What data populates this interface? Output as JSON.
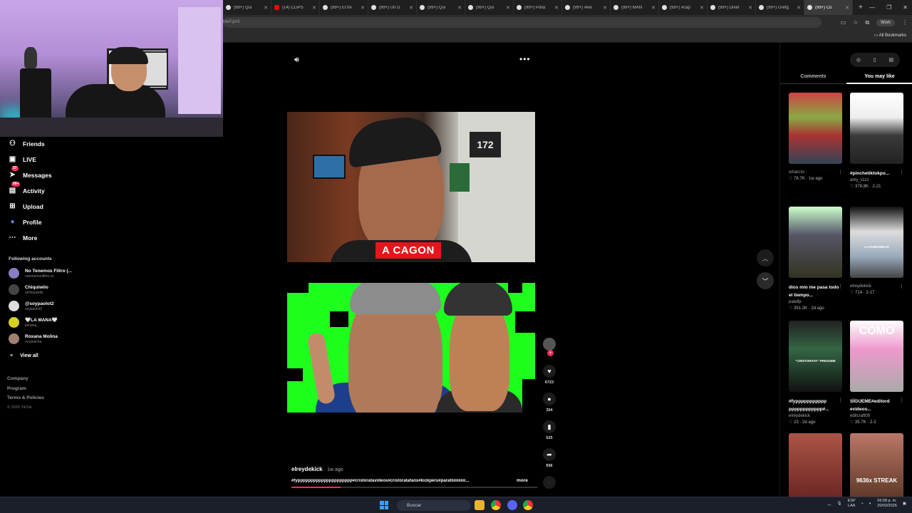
{
  "browser": {
    "tabs": [
      {
        "label": "(99+) Qui",
        "icon": "tiktok-icon"
      },
      {
        "label": "(14) CLIPS",
        "icon": "youtube-icon"
      },
      {
        "label": "(99+) El tre",
        "icon": "tiktok-icon"
      },
      {
        "label": "(99+) Un D",
        "icon": "tiktok-icon"
      },
      {
        "label": "(99+) Qui",
        "icon": "tiktok-icon"
      },
      {
        "label": "(99+) Qui",
        "icon": "tiktok-icon"
      },
      {
        "label": "(99+) Polla",
        "icon": "tiktok-icon"
      },
      {
        "label": "(99+) #we",
        "icon": "tiktok-icon"
      },
      {
        "label": "(99+) MAN",
        "icon": "tiktok-icon"
      },
      {
        "label": "(99+) #cap",
        "icon": "tiktok-icon"
      },
      {
        "label": "(99+) Diver",
        "icon": "tiktok-icon"
      },
      {
        "label": "(99+) Grefg",
        "icon": "tiktok-icon"
      },
      {
        "label": "(99+) Co",
        "icon": "tiktok-icon"
      }
    ],
    "address_text": "MeFqm5",
    "profile_label": "Work",
    "all_bookmarks": "All Bookmarks"
  },
  "sidebar": {
    "nav": [
      {
        "label": "Friends",
        "icon": "friends-icon",
        "badge": ""
      },
      {
        "label": "LIVE",
        "icon": "live-icon",
        "badge": ""
      },
      {
        "label": "Messages",
        "icon": "messages-icon",
        "badge": "37"
      },
      {
        "label": "Activity",
        "icon": "activity-icon",
        "badge": "99+"
      },
      {
        "label": "Upload",
        "icon": "upload-icon",
        "badge": ""
      },
      {
        "label": "Profile",
        "icon": "profile-icon",
        "badge": ""
      },
      {
        "label": "More",
        "icon": "more-icon",
        "badge": ""
      }
    ],
    "following_title": "Following accounts",
    "accounts": [
      {
        "name": "No Tenemos Filtro (...",
        "handle": "notenemosfiltro.zs"
      },
      {
        "name": "Chiquiwilo",
        "handle": "elchiquiwilo"
      },
      {
        "name": "@soypaolot2",
        "handle": "soypaolot2"
      },
      {
        "name": "🤍LA MANA🤍",
        "handle": "lamana_"
      },
      {
        "name": "Roxana Molina",
        "handle": "roxanacha"
      }
    ],
    "view_all": "View all",
    "footer": [
      "Company",
      "Program",
      "Terms & Policies"
    ],
    "copyright": "© 2026 TikTok"
  },
  "video": {
    "caption_overlay": "A CAGON",
    "shop_sign": "172",
    "author": "elreydekick",
    "time_ago": "1w ago",
    "hashtags": "#fyppppppppppppppppppppp#cristoratavideos#cristoratafans#kickperu#paratiiiiiiiiiiii...",
    "more_label": "more",
    "likes": "6723",
    "comments": "354",
    "saves": "525",
    "shares": "656",
    "progress_fraction": 0.2
  },
  "right_panel": {
    "tabs": [
      "Comments",
      "You may like"
    ],
    "active_tab": "You may like",
    "cards": [
      {
        "title": "",
        "author": "omari.to",
        "stats": "♡ 78.7K · 1w ago",
        "thumb": "t1",
        "overlay": ""
      },
      {
        "title": "#pinchetiktokpo...",
        "author": "amy_vzzz",
        "stats": "♡ 378.8K · 2-21",
        "thumb": "t2",
        "overlay": ""
      },
      {
        "title": "dios mío me pasa todo el tiempo...",
        "author": "palaflp",
        "stats": "♡ 351.2K · 2d ago",
        "thumb": "t3",
        "overlay": ""
      },
      {
        "title": "",
        "author": "elreydekick",
        "stats": "♡ 714 · 2-17",
        "thumb": "t4",
        "overlay": "LA HUMANIDAD"
      },
      {
        "title": "#fyppppppppppp pppppppppppp#...",
        "author": "elreydekick",
        "stats": "♡ 23 · 2d ago",
        "thumb": "t5",
        "overlay": "\"CRISTORATA\" PRESUME"
      },
      {
        "title": "SÍGUEME#editord evideos...",
        "author": "editcraft09",
        "stats": "♡ 35.7K · 2-2",
        "thumb": "t6",
        "overlay": "CÓMO"
      },
      {
        "title": "",
        "author": "",
        "stats": "",
        "thumb": "t7",
        "overlay": ""
      },
      {
        "title": "",
        "author": "",
        "stats": "",
        "thumb": "t8",
        "overlay": "9636x STREAK"
      }
    ]
  },
  "taskbar": {
    "search_placeholder": "Buscar",
    "lang_top": "ESP",
    "lang_bottom": "LAA",
    "time": "06:08 p. m.",
    "date": "20/03/2026"
  }
}
